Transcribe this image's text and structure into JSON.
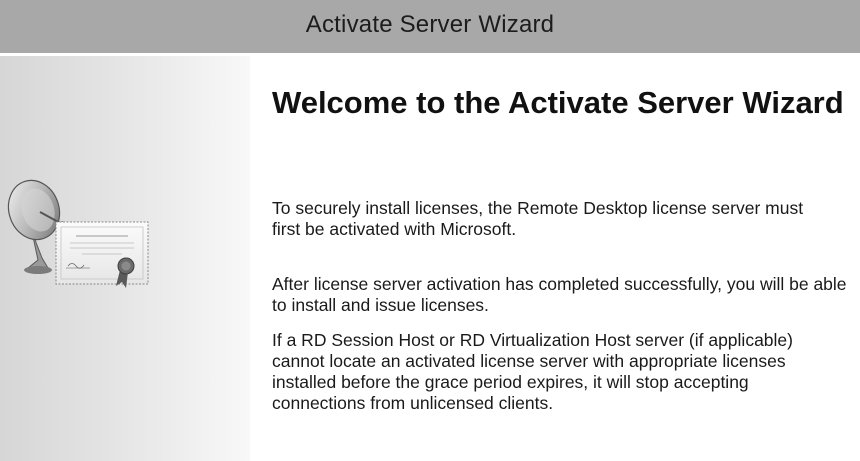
{
  "window": {
    "title": "Activate Server Wizard"
  },
  "sidebar": {
    "illustration_icon": "satellite-dish-certificate-icon"
  },
  "welcome": {
    "heading": "Welcome to the Activate Server Wizard",
    "paragraph_1": "To securely install licenses, the Remote Desktop license server must first be activated with Microsoft.",
    "paragraph_2": "After license server activation has completed successfully, you will be able to install and issue licenses.",
    "paragraph_3": "If a RD Session Host or RD Virtualization Host server (if applicable) cannot locate an activated license server with appropriate licenses installed before the grace period expires, it will stop accepting connections from unlicensed clients."
  },
  "colors": {
    "titlebar_bg": "#a8a8a8",
    "sidebar_gradient_start": "#d6d6d6",
    "sidebar_gradient_end": "#f8f8f8",
    "text": "#1a1a1a"
  }
}
